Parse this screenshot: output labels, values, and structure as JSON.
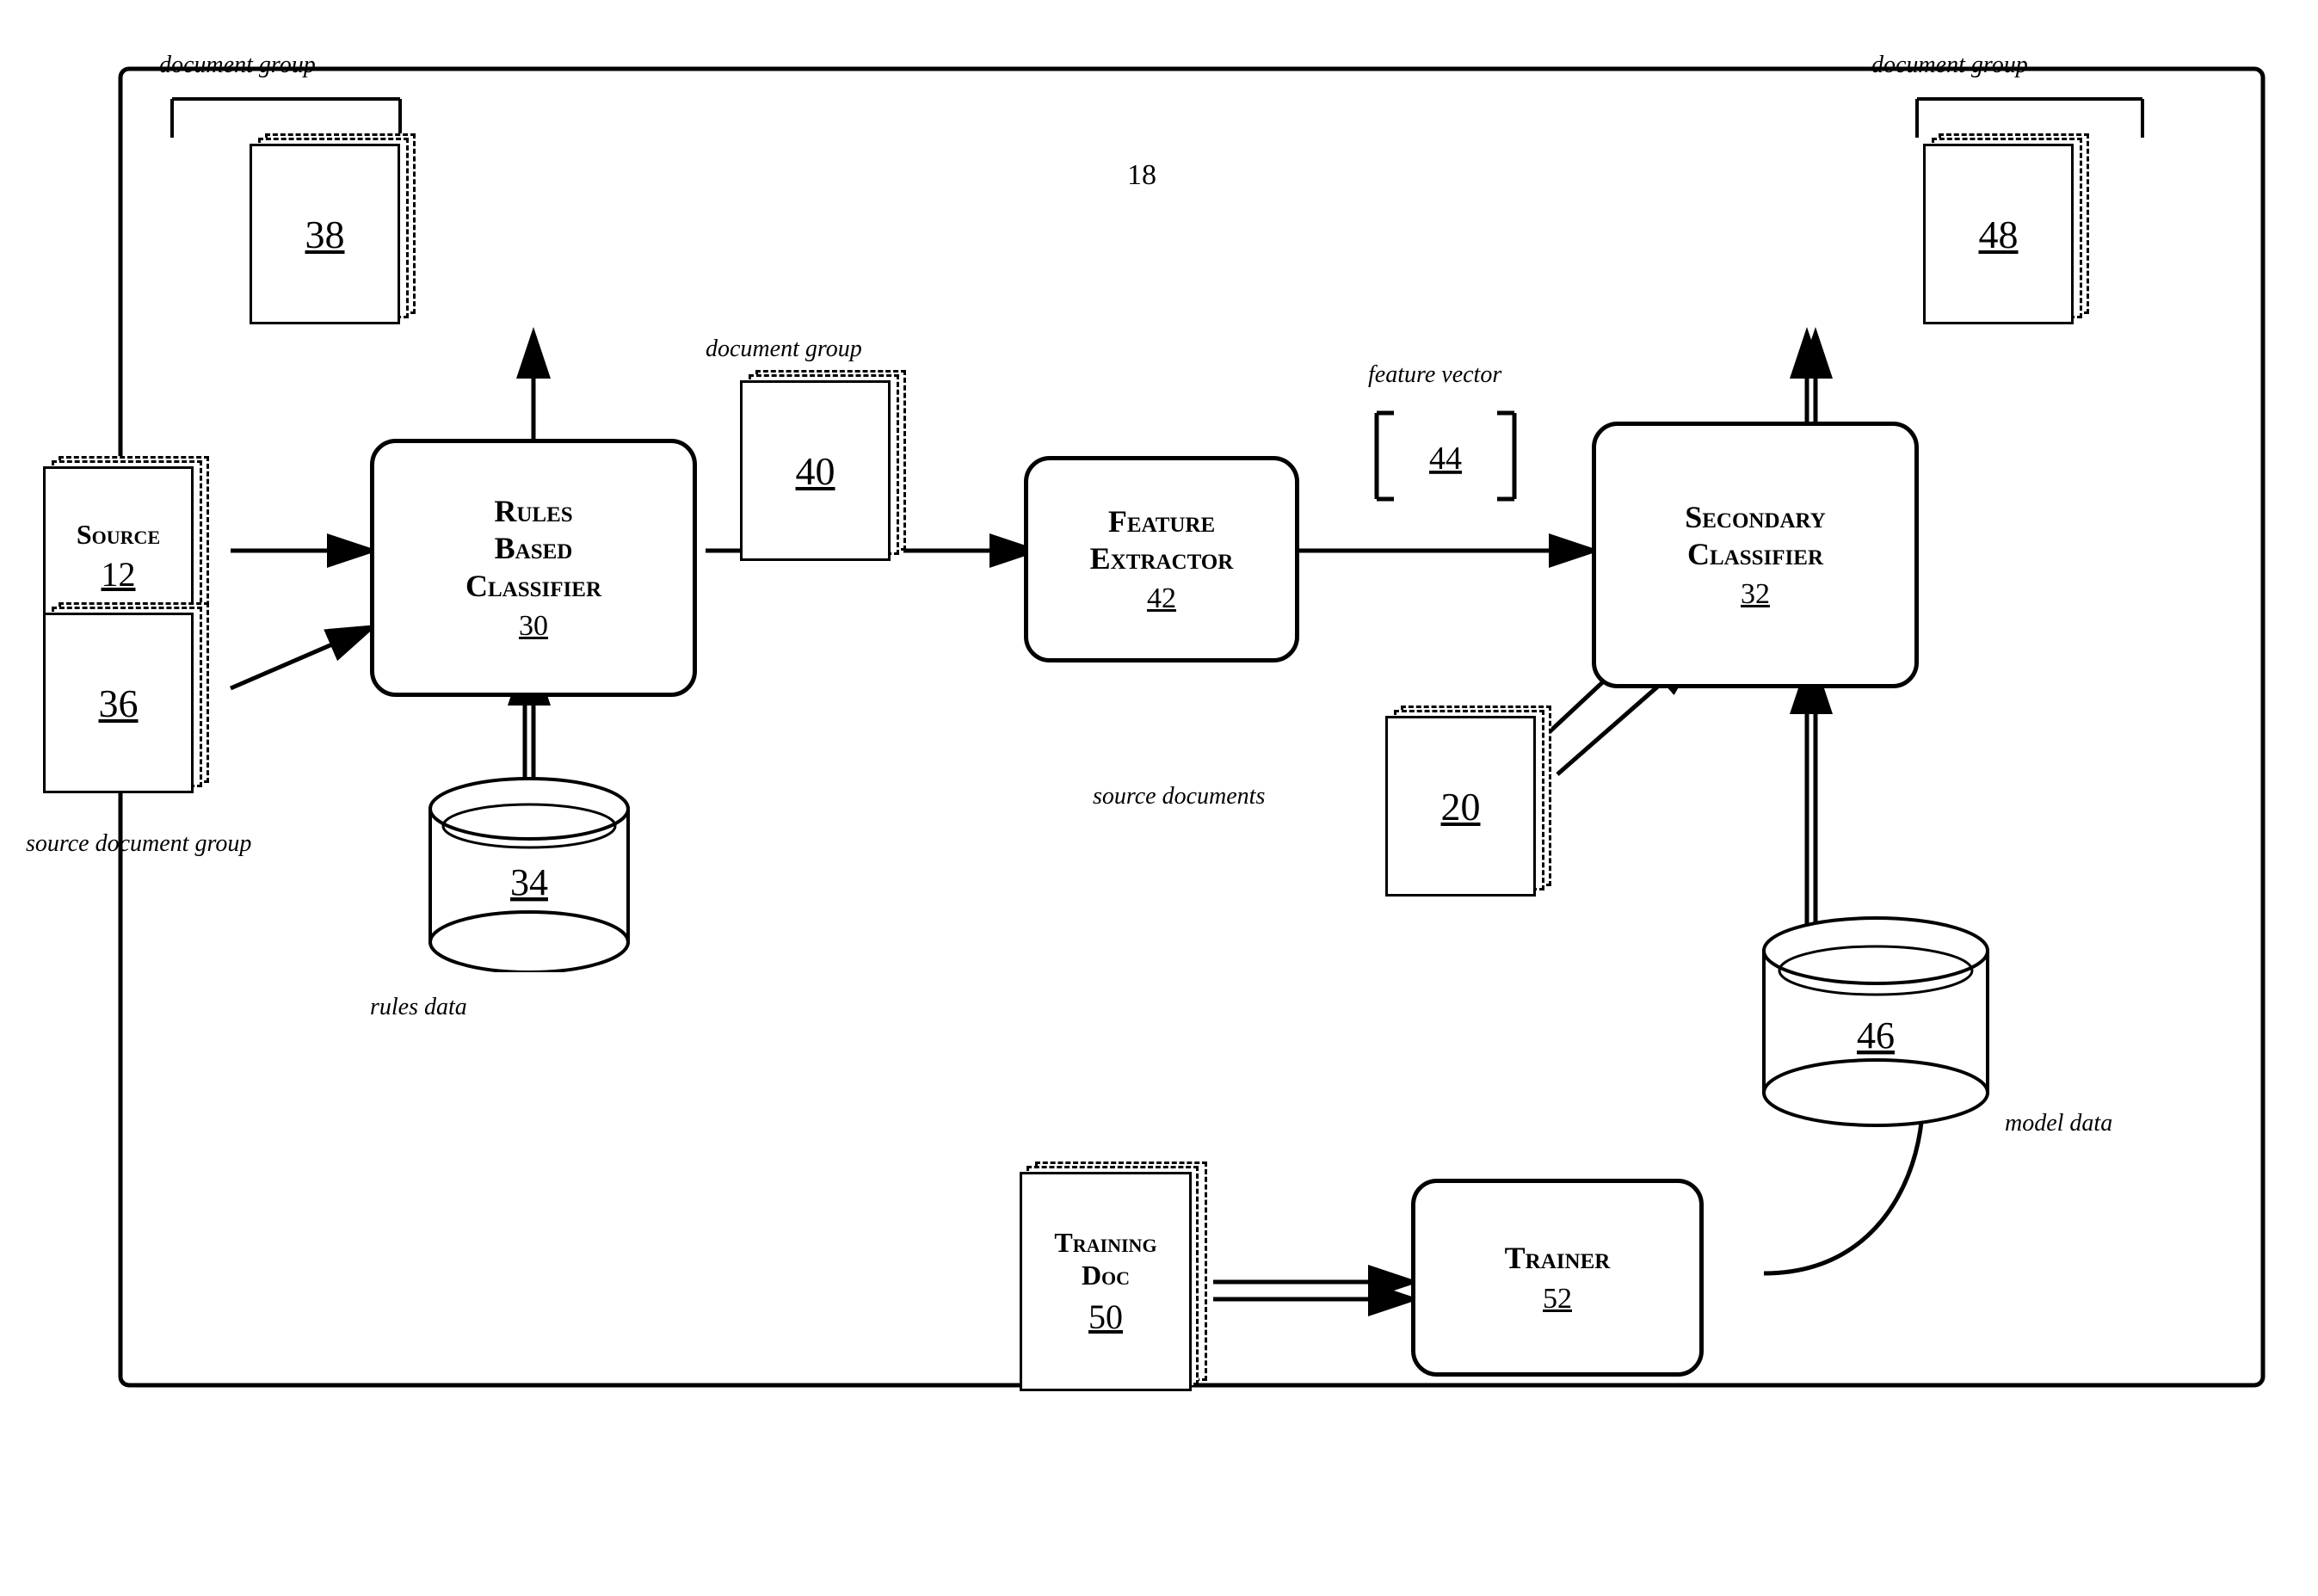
{
  "labels": {
    "doc_group_top_left": "document group",
    "doc_group_top_right": "document group",
    "doc_group_middle": "document group",
    "feature_vector": "feature vector",
    "source_doc_group": "source document group",
    "rules_data": "rules data",
    "source_documents": "source documents",
    "model_data": "model data",
    "number_18": "18"
  },
  "boxes": {
    "rules_classifier": {
      "title": "Rules\nBased\nClassifier",
      "number": "30"
    },
    "feature_extractor": {
      "title": "Feature\nExtractor",
      "number": "42"
    },
    "secondary_classifier": {
      "title": "Secondary\nClassifier",
      "number": "32"
    },
    "trainer": {
      "title": "Trainer",
      "number": "52"
    }
  },
  "documents": {
    "source_12": "12",
    "doc_36": "36",
    "doc_38": "38",
    "doc_40": "40",
    "doc_48": "48",
    "doc_20": "20",
    "training_doc_50": "50",
    "training_doc_label": "Training\nDoc"
  },
  "cylinders": {
    "rules_34": "34",
    "model_46": "46"
  },
  "feature_vector_id": "44"
}
